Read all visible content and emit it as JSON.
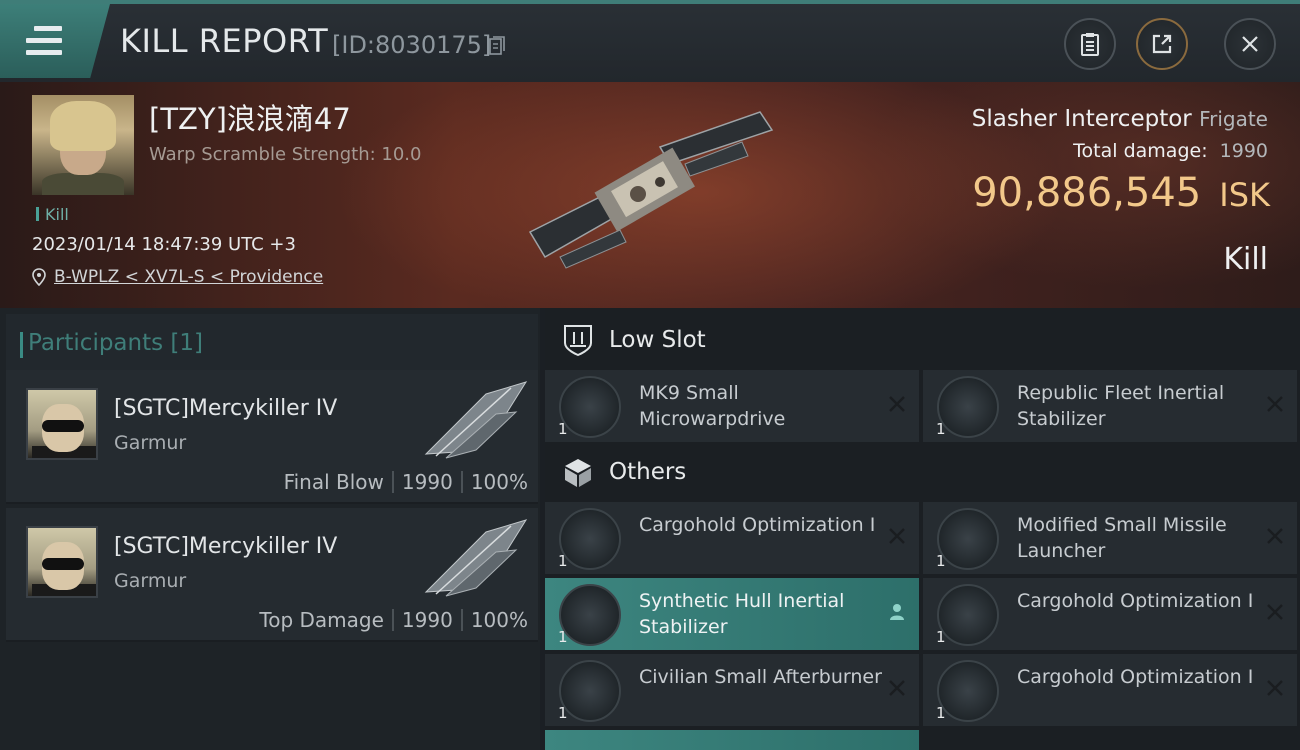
{
  "header": {
    "title": "KILL REPORT",
    "report_id": "[ID:8030175]"
  },
  "victim": {
    "name": "[TZY]浪浪滴47",
    "scramble": "Warp Scramble Strength: 10.0",
    "tag": "Kill",
    "datetime": "2023/01/14 18:47:39 UTC +3",
    "location": "B-WPLZ < XV7L-S < Providence",
    "ship_name": "Slasher Interceptor",
    "ship_class": "Frigate",
    "total_damage_label": "Total damage:",
    "total_damage": "1990",
    "isk_value": "90,886,545",
    "isk_unit": "ISK",
    "result": "Kill"
  },
  "participants": {
    "title": "Participants [1]",
    "rows": [
      {
        "name": "[SGTC]Mercykiller IV",
        "ship": "Garmur",
        "role": "Final Blow",
        "damage": "1990",
        "percent": "100%"
      },
      {
        "name": "[SGTC]Mercykiller IV",
        "ship": "Garmur",
        "role": "Top Damage",
        "damage": "1990",
        "percent": "100%"
      }
    ]
  },
  "fittings": {
    "low_slot_label": "Low Slot",
    "others_label": "Others",
    "low_slot": [
      {
        "name": "MK9 Small Microwarpdrive",
        "qty": "1",
        "icon": "microwarpdrive-icon"
      },
      {
        "name": "Republic Fleet Inertial Stabilizer",
        "qty": "1",
        "icon": "inertial-stabilizer-icon"
      }
    ],
    "others": [
      {
        "name": "Cargohold Optimization I",
        "qty": "1",
        "icon": "cargohold-icon"
      },
      {
        "name": "Modified Small Missile Launcher",
        "qty": "1",
        "icon": "missile-launcher-icon"
      },
      {
        "name": "Synthetic Hull Inertial Stabilizer",
        "qty": "1",
        "icon": "inertial-stabilizer-icon",
        "highlighted": true
      },
      {
        "name": "Cargohold Optimization I",
        "qty": "1",
        "icon": "cargohold-icon"
      },
      {
        "name": "Civilian Small Afterburner",
        "qty": "1",
        "icon": "afterburner-icon"
      },
      {
        "name": "Cargohold Optimization I",
        "qty": "1",
        "icon": "cargohold-icon"
      }
    ]
  },
  "colors": {
    "accent": "#3f7d78",
    "isk": "#f2c88a",
    "highlight_row": "#3d8680"
  }
}
